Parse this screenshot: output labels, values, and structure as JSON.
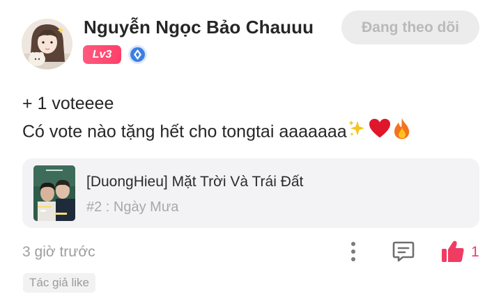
{
  "user": {
    "name": "Nguyễn Ngọc Bảo Chauuu",
    "level": "Lv3",
    "follow_label": "Đang theo dõi"
  },
  "post": {
    "line1": "+ 1 voteeee",
    "line2_text": "Có vote nào tặng hết cho tongtai aaaaaaa"
  },
  "story": {
    "title": "[DuongHieu] Mặt Trời Và Trái Đất",
    "chapter": "#2 : Ngày Mưa"
  },
  "footer": {
    "timestamp": "3 giờ trước",
    "like_count": "1",
    "author_like_tag": "Tác giả like"
  },
  "colors": {
    "accent_pink": "#f03b63",
    "level_badge": "#ff4a72",
    "follow_bg": "#ececec",
    "card_bg": "#f3f3f5",
    "author_badge_blue": "#3d7fe0"
  },
  "icons": {
    "more": "more-vertical-icon",
    "comment": "comment-icon",
    "like": "thumbs-up-icon",
    "author_badge": "author-badge-icon",
    "sparkles": "sparkles-icon",
    "heart": "heart-icon",
    "fire": "fire-icon"
  }
}
